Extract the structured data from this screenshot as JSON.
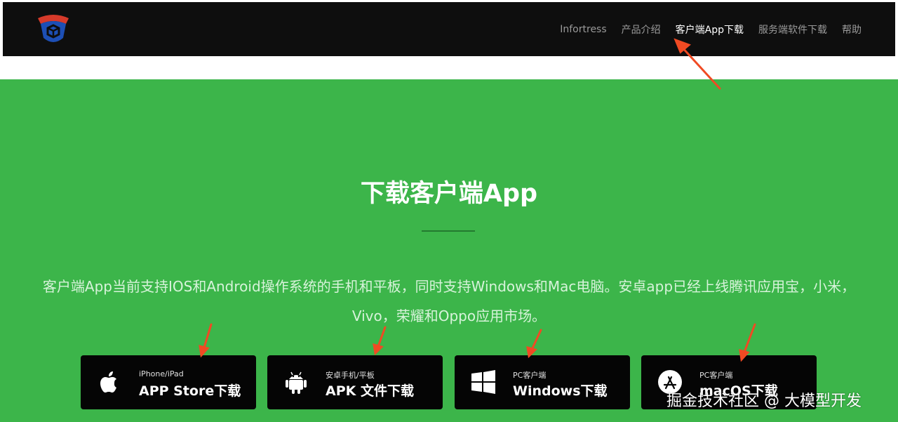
{
  "nav": {
    "links": [
      {
        "label": "Infortress"
      },
      {
        "label": "产品介绍"
      },
      {
        "label": "客户端App下载"
      },
      {
        "label": "服务端软件下载"
      },
      {
        "label": "帮助"
      }
    ],
    "active_index": 2
  },
  "hero": {
    "title": "下载客户端App",
    "description": "客户端App当前支持IOS和Android操作系统的手机和平板，同时支持Windows和Mac电脑。安卓app已经上线腾讯应用宝，小米，Vivo，荣耀和Oppo应用市场。"
  },
  "downloads": [
    {
      "small": "iPhone/iPad",
      "big": "APP Store下载",
      "icon": "apple-icon"
    },
    {
      "small": "安卓手机/平板",
      "big": "APK 文件下载",
      "icon": "android-icon"
    },
    {
      "small": "PC客户端",
      "big": "Windows下载",
      "icon": "windows-icon"
    },
    {
      "small": "PC客户端",
      "big": "macOS下载",
      "icon": "app-store-icon"
    }
  ],
  "watermark": "掘金技术社区 @ 大模型开发",
  "colors": {
    "nav_bg": "#0e0e0e",
    "hero_bg": "#3cb54a",
    "button_bg": "#050505",
    "annotation_arrow": "#f04a23"
  }
}
